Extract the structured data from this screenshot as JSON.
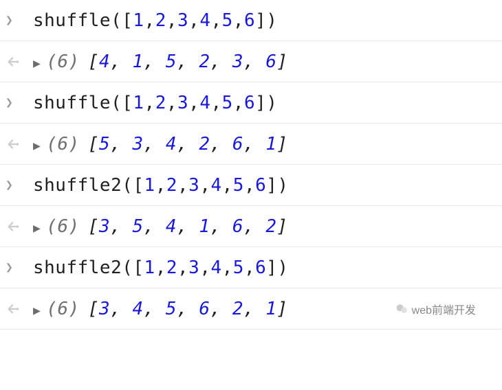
{
  "console": {
    "entries": [
      {
        "type": "input",
        "fn": "shuffle",
        "args": [
          1,
          2,
          3,
          4,
          5,
          6
        ]
      },
      {
        "type": "output",
        "length": 6,
        "values": [
          4,
          1,
          5,
          2,
          3,
          6
        ]
      },
      {
        "type": "input",
        "fn": "shuffle",
        "args": [
          1,
          2,
          3,
          4,
          5,
          6
        ]
      },
      {
        "type": "output",
        "length": 6,
        "values": [
          5,
          3,
          4,
          2,
          6,
          1
        ]
      },
      {
        "type": "input",
        "fn": "shuffle2",
        "args": [
          1,
          2,
          3,
          4,
          5,
          6
        ]
      },
      {
        "type": "output",
        "length": 6,
        "values": [
          3,
          5,
          4,
          1,
          6,
          2
        ]
      },
      {
        "type": "input",
        "fn": "shuffle2",
        "args": [
          1,
          2,
          3,
          4,
          5,
          6
        ]
      },
      {
        "type": "output",
        "length": 6,
        "values": [
          3,
          4,
          5,
          6,
          2,
          1
        ]
      }
    ]
  },
  "watermark": {
    "text": "web前端开发"
  }
}
